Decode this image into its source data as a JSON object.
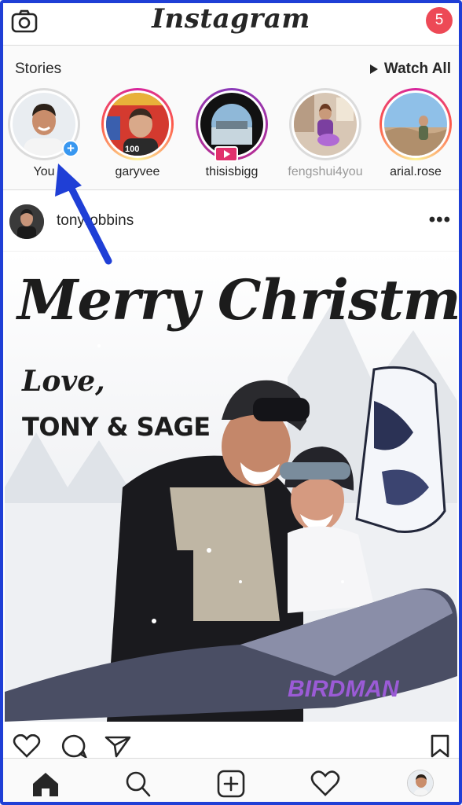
{
  "app": {
    "title": "Instagram",
    "notification_count": "5"
  },
  "stories": {
    "title": "Stories",
    "watch_all_label": "Watch All",
    "items": [
      {
        "name": "You",
        "seen": false,
        "badge": "plus"
      },
      {
        "name": "garyvee",
        "seen": false,
        "badge": ""
      },
      {
        "name": "thisisbigg",
        "seen": false,
        "badge": "live"
      },
      {
        "name": "fengshui4you",
        "seen": true,
        "badge": ""
      },
      {
        "name": "arial.rose",
        "seen": false,
        "badge": ""
      }
    ]
  },
  "post": {
    "username": "tonyrobbins",
    "more_label": "•••",
    "image_text": {
      "headline": "Merry Christmas",
      "love": "Love,",
      "signoff": "TONY & SAGE"
    }
  },
  "icons": {
    "camera": "camera-icon",
    "like": "heart-outline-icon",
    "comment": "comment-icon",
    "share": "send-icon",
    "save": "bookmark-icon",
    "home": "home-icon",
    "search": "search-icon",
    "add": "add-post-icon",
    "activity": "heart-icon",
    "profile": "profile-avatar"
  },
  "colors": {
    "frame": "#1f3fd6",
    "notification": "#ed4956",
    "plus_badge": "#3897f0",
    "live_badge": "#e1306c",
    "arrow": "#1f3fd6"
  }
}
